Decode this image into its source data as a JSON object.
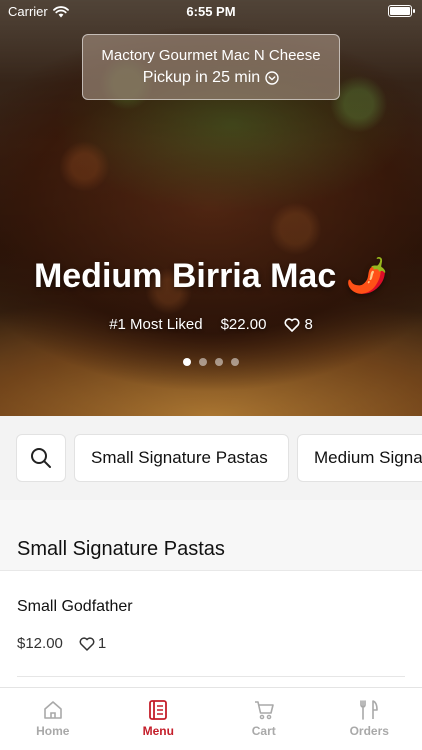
{
  "status_bar": {
    "carrier": "Carrier",
    "time": "6:55 PM"
  },
  "restaurant": {
    "name": "Mactory Gourmet Mac N Cheese",
    "pickup": "Pickup in 25 min"
  },
  "hero": {
    "title": "Medium Birria Mac 🌶️",
    "badge": "#1 Most Liked",
    "price": "$22.00",
    "likes": "8",
    "carousel": {
      "count": 4,
      "active": 1
    }
  },
  "categories": [
    "Small Signature Pastas",
    "Medium Signature Pastas"
  ],
  "section": {
    "title": "Small Signature Pastas",
    "items": [
      {
        "name": "Small Godfather",
        "price": "$12.00",
        "likes": "1"
      }
    ]
  },
  "tabs": [
    {
      "label": "Home",
      "icon": "home-icon"
    },
    {
      "label": "Menu",
      "icon": "menu-icon"
    },
    {
      "label": "Cart",
      "icon": "cart-icon"
    },
    {
      "label": "Orders",
      "icon": "orders-icon"
    }
  ],
  "colors": {
    "accent": "#c41e2a",
    "inactive": "#a9a9a9"
  }
}
